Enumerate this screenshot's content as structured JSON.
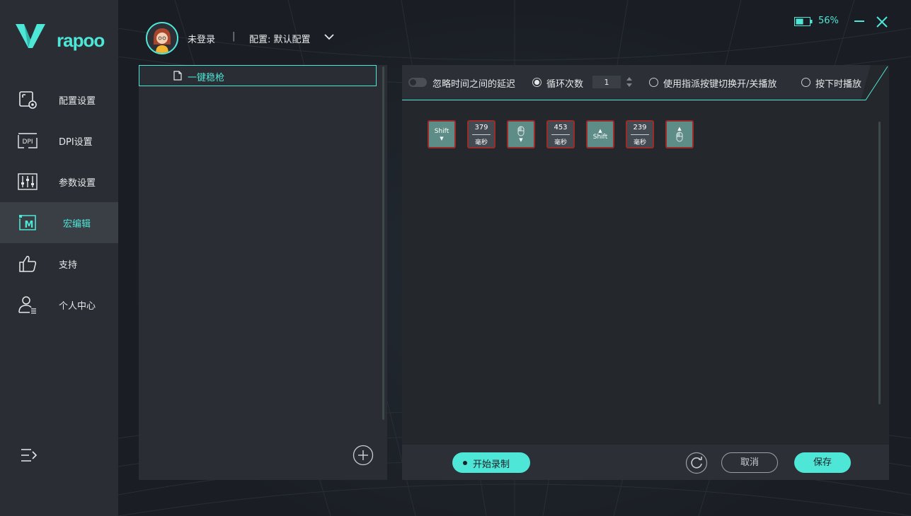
{
  "app": {
    "brand": "rapoo",
    "accent_color": "#4ee6d6",
    "battery_percent": "56%",
    "battery_level": 0.56
  },
  "sidebar": {
    "items": [
      {
        "label": "配置设置",
        "icon": "config-icon",
        "active": false
      },
      {
        "label": "DPI设置",
        "icon": "dpi-icon",
        "active": false
      },
      {
        "label": "参数设置",
        "icon": "sliders-icon",
        "active": false
      },
      {
        "label": "宏编辑",
        "icon": "macro-icon",
        "active": true
      },
      {
        "label": "支持",
        "icon": "thumbs-up-icon",
        "active": false
      },
      {
        "label": "个人中心",
        "icon": "user-icon",
        "active": false
      }
    ],
    "dpi_icon_text": "DPI",
    "macro_icon_text": "M"
  },
  "header": {
    "user": "未登录",
    "separator": "|",
    "config": "配置: 默认配置"
  },
  "macro_list": {
    "items": [
      {
        "label": "一键稳枪",
        "selected": true
      }
    ]
  },
  "toolbar": {
    "ignore_delay": "忽略时间之间的延迟",
    "loop_count_label": "循环次数",
    "loop_count_value": "1",
    "toggle_play": "使用指派按键切换开/关播放",
    "hold_play": "按下时播放",
    "selected_mode": "loop"
  },
  "macro_steps": [
    {
      "type": "key",
      "label": "Shift",
      "action": "down"
    },
    {
      "type": "delay",
      "value": "379",
      "unit": "毫秒"
    },
    {
      "type": "mouse",
      "label": "",
      "action": "down"
    },
    {
      "type": "delay",
      "value": "453",
      "unit": "毫秒"
    },
    {
      "type": "key",
      "label": "Shift",
      "action": "up"
    },
    {
      "type": "delay",
      "value": "239",
      "unit": "毫秒"
    },
    {
      "type": "mouse",
      "label": "",
      "action": "up"
    }
  ],
  "footer": {
    "record": "开始录制",
    "cancel": "取消",
    "save": "保存"
  }
}
